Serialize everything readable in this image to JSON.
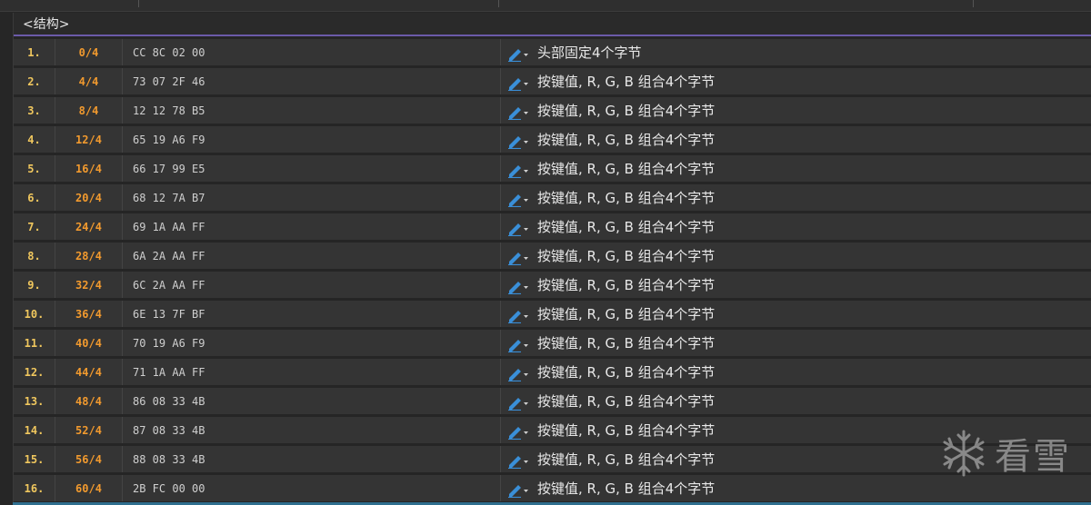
{
  "panel": {
    "title": "<结构>"
  },
  "rows": [
    {
      "index": "1.",
      "offset": "0/4",
      "hex": "CC 8C 02 00",
      "comment": "头部固定4个字节"
    },
    {
      "index": "2.",
      "offset": "4/4",
      "hex": "73 07 2F 46",
      "comment": "按键值, R, G, B 组合4个字节"
    },
    {
      "index": "3.",
      "offset": "8/4",
      "hex": "12 12 78 B5",
      "comment": "按键值, R, G, B 组合4个字节"
    },
    {
      "index": "4.",
      "offset": "12/4",
      "hex": "65 19 A6 F9",
      "comment": "按键值, R, G, B 组合4个字节"
    },
    {
      "index": "5.",
      "offset": "16/4",
      "hex": "66 17 99 E5",
      "comment": "按键值, R, G, B 组合4个字节"
    },
    {
      "index": "6.",
      "offset": "20/4",
      "hex": "68 12 7A B7",
      "comment": "按键值, R, G, B 组合4个字节"
    },
    {
      "index": "7.",
      "offset": "24/4",
      "hex": "69 1A AA FF",
      "comment": "按键值, R, G, B 组合4个字节"
    },
    {
      "index": "8.",
      "offset": "28/4",
      "hex": "6A 2A AA FF",
      "comment": "按键值, R, G, B 组合4个字节"
    },
    {
      "index": "9.",
      "offset": "32/4",
      "hex": "6C 2A AA FF",
      "comment": "按键值, R, G, B 组合4个字节"
    },
    {
      "index": "10.",
      "offset": "36/4",
      "hex": "6E 13 7F BF",
      "comment": "按键值, R, G, B 组合4个字节"
    },
    {
      "index": "11.",
      "offset": "40/4",
      "hex": "70 19 A6 F9",
      "comment": "按键值, R, G, B 组合4个字节"
    },
    {
      "index": "12.",
      "offset": "44/4",
      "hex": "71 1A AA FF",
      "comment": "按键值, R, G, B 组合4个字节"
    },
    {
      "index": "13.",
      "offset": "48/4",
      "hex": "86 08 33 4B",
      "comment": "按键值, R, G, B 组合4个字节"
    },
    {
      "index": "14.",
      "offset": "52/4",
      "hex": "87 08 33 4B",
      "comment": "按键值, R, G, B 组合4个字节"
    },
    {
      "index": "15.",
      "offset": "56/4",
      "hex": "88 08 33 4B",
      "comment": "按键值, R, G, B 组合4个字节"
    },
    {
      "index": "16.",
      "offset": "60/4",
      "hex": "2B FC 00 00",
      "comment": "按键值, R, G, B 组合4个字节"
    }
  ],
  "icons": {
    "edit": "pencil-dropdown-icon",
    "watermark": "snowflake-icon"
  },
  "colors": {
    "index": "#f0c75e",
    "offset": "#f29a2e",
    "edit_icon": "#3a8fd8",
    "header_underline": "#6b5aa8"
  },
  "watermark": {
    "text": "看雪"
  }
}
